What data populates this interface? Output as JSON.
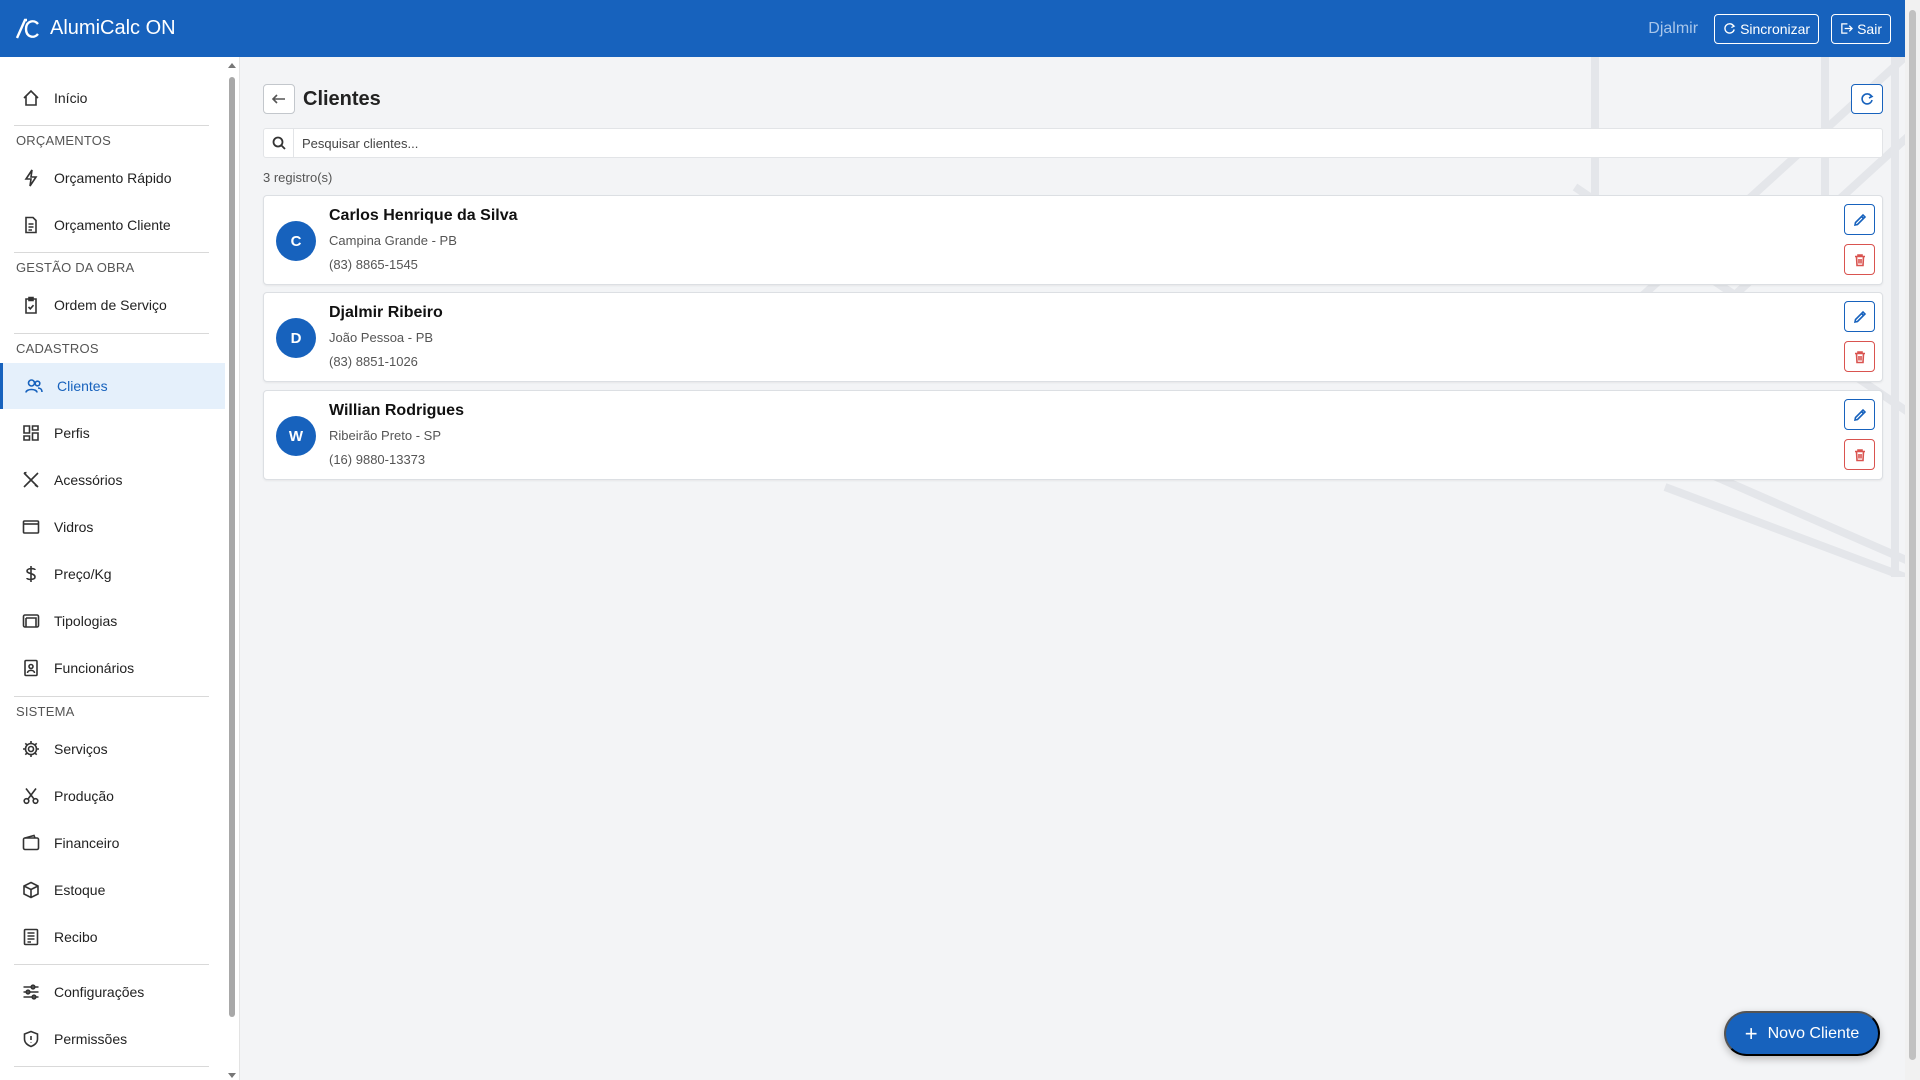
{
  "app": {
    "title": "AlumiCalc ON",
    "user": "Djalmir",
    "sync_label": "Sincronizar",
    "logout_label": "Sair"
  },
  "colors": {
    "primary": "#1762bd",
    "danger": "#d9534f",
    "background": "#f3f4f6"
  },
  "sidebar": {
    "home": {
      "label": "Início",
      "icon": "home-icon"
    },
    "sections": [
      {
        "title": "ORÇAMENTOS",
        "items": [
          {
            "label": "Orçamento Rápido",
            "icon": "bolt-icon"
          },
          {
            "label": "Orçamento Cliente",
            "icon": "document-icon"
          }
        ]
      },
      {
        "title": "GESTÃO DA OBRA",
        "items": [
          {
            "label": "Ordem de Serviço",
            "icon": "clipboard-icon"
          }
        ]
      },
      {
        "title": "CADASTROS",
        "items": [
          {
            "label": "Clientes",
            "icon": "users-icon",
            "active": true
          },
          {
            "label": "Perfis",
            "icon": "grid-icon"
          },
          {
            "label": "Acessórios",
            "icon": "tools-icon"
          },
          {
            "label": "Vidros",
            "icon": "window-icon"
          },
          {
            "label": "Preço/Kg",
            "icon": "dollar-icon"
          },
          {
            "label": "Tipologias",
            "icon": "layers-icon"
          },
          {
            "label": "Funcionários",
            "icon": "badge-icon"
          }
        ]
      },
      {
        "title": "SISTEMA",
        "items": [
          {
            "label": "Serviços",
            "icon": "gear-icon"
          },
          {
            "label": "Produção",
            "icon": "scissors-icon"
          },
          {
            "label": "Financeiro",
            "icon": "wallet-icon"
          },
          {
            "label": "Estoque",
            "icon": "box-icon"
          },
          {
            "label": "Recibo",
            "icon": "receipt-icon"
          }
        ]
      }
    ],
    "footer": [
      {
        "label": "Configurações",
        "icon": "sliders-icon"
      },
      {
        "label": "Permissões",
        "icon": "shield-icon"
      }
    ]
  },
  "page": {
    "title": "Clientes",
    "search_placeholder": "Pesquisar clientes...",
    "count_label": "3 registro(s)",
    "new_button": "Novo Cliente"
  },
  "clients": [
    {
      "initial": "C",
      "name": "Carlos Henrique da Silva",
      "city": "Campina Grande - PB",
      "phone": "(83) 8865-1545"
    },
    {
      "initial": "D",
      "name": "Djalmir Ribeiro",
      "city": "João Pessoa - PB",
      "phone": "(83) 8851-1026"
    },
    {
      "initial": "W",
      "name": "Willian Rodrigues",
      "city": "Ribeirão Preto - SP",
      "phone": "(16) 9880-13373"
    }
  ]
}
